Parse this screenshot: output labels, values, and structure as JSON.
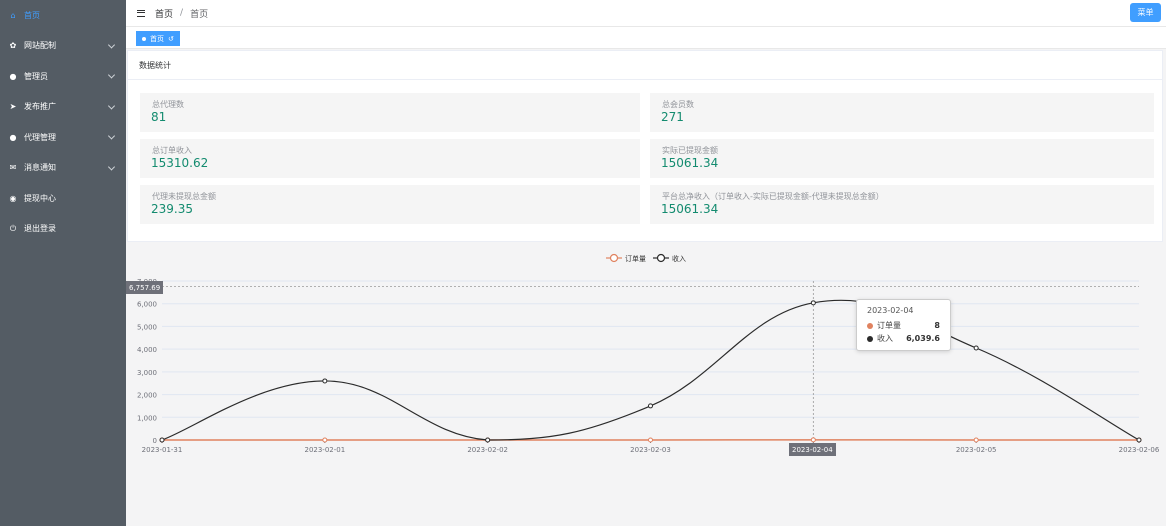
{
  "sidebar": {
    "items": [
      {
        "label": "首页",
        "icon": "home-icon",
        "glyph": "⌂",
        "active": true,
        "has_children": false
      },
      {
        "label": "网站配制",
        "icon": "gear-icon",
        "glyph": "✿",
        "active": false,
        "has_children": true
      },
      {
        "label": "管理员",
        "icon": "user-icon",
        "glyph": "●",
        "active": false,
        "has_children": true
      },
      {
        "label": "发布推广",
        "icon": "send-icon",
        "glyph": "➤",
        "active": false,
        "has_children": true
      },
      {
        "label": "代理管理",
        "icon": "user-icon",
        "glyph": "●",
        "active": false,
        "has_children": true
      },
      {
        "label": "消息通知",
        "icon": "message-icon",
        "glyph": "✉",
        "active": false,
        "has_children": true
      },
      {
        "label": "提现中心",
        "icon": "coin-icon",
        "glyph": "◉",
        "active": false,
        "has_children": false
      },
      {
        "label": "退出登录",
        "icon": "power-icon",
        "glyph": "⏻",
        "active": false,
        "has_children": false
      }
    ]
  },
  "header": {
    "breadcrumb": [
      "首页",
      "首页"
    ],
    "menu_button": "菜单"
  },
  "tags": [
    {
      "label": "首页",
      "close": "↺"
    }
  ],
  "stats": {
    "title": "数据统计",
    "items": [
      {
        "label": "总代理数",
        "value": "81"
      },
      {
        "label": "总会员数",
        "value": "271"
      },
      {
        "label": "总订单收入",
        "value": "15310.62"
      },
      {
        "label": "实际已提现金额",
        "value": "15061.34"
      },
      {
        "label": "代理未提现总金额",
        "value": "239.35"
      },
      {
        "label": "平台总净收入（订单收入-实际已提现金额-代理未提现总金额）",
        "value": "15061.34"
      }
    ]
  },
  "chart_data": {
    "type": "line",
    "x": [
      "2023-01-31",
      "2023-02-01",
      "2023-02-02",
      "2023-02-03",
      "2023-02-04",
      "2023-02-05",
      "2023-02-06"
    ],
    "series": [
      {
        "name": "订单量",
        "values": [
          0,
          0,
          0,
          0,
          8,
          0,
          0
        ],
        "color": "#e0825f"
      },
      {
        "name": "收入",
        "values": [
          0,
          2600,
          0,
          1500,
          6039.6,
          4050,
          0
        ],
        "color": "#2b2b2b"
      }
    ],
    "ylim": [
      0,
      7000
    ],
    "yticks": [
      "0",
      "1,000",
      "2,000",
      "3,000",
      "4,000",
      "5,000",
      "6,000",
      "7,000"
    ],
    "legend": "top-center",
    "smooth": true,
    "axis_pointer_y": "6,757.69",
    "axis_pointer_x": "2023-02-04",
    "tooltip": {
      "title": "2023-02-04",
      "rows": [
        {
          "name": "订单量",
          "value": "8",
          "color": "#e0825f"
        },
        {
          "name": "收入",
          "value": "6,039.6",
          "color": "#2b2b2b"
        }
      ]
    }
  }
}
